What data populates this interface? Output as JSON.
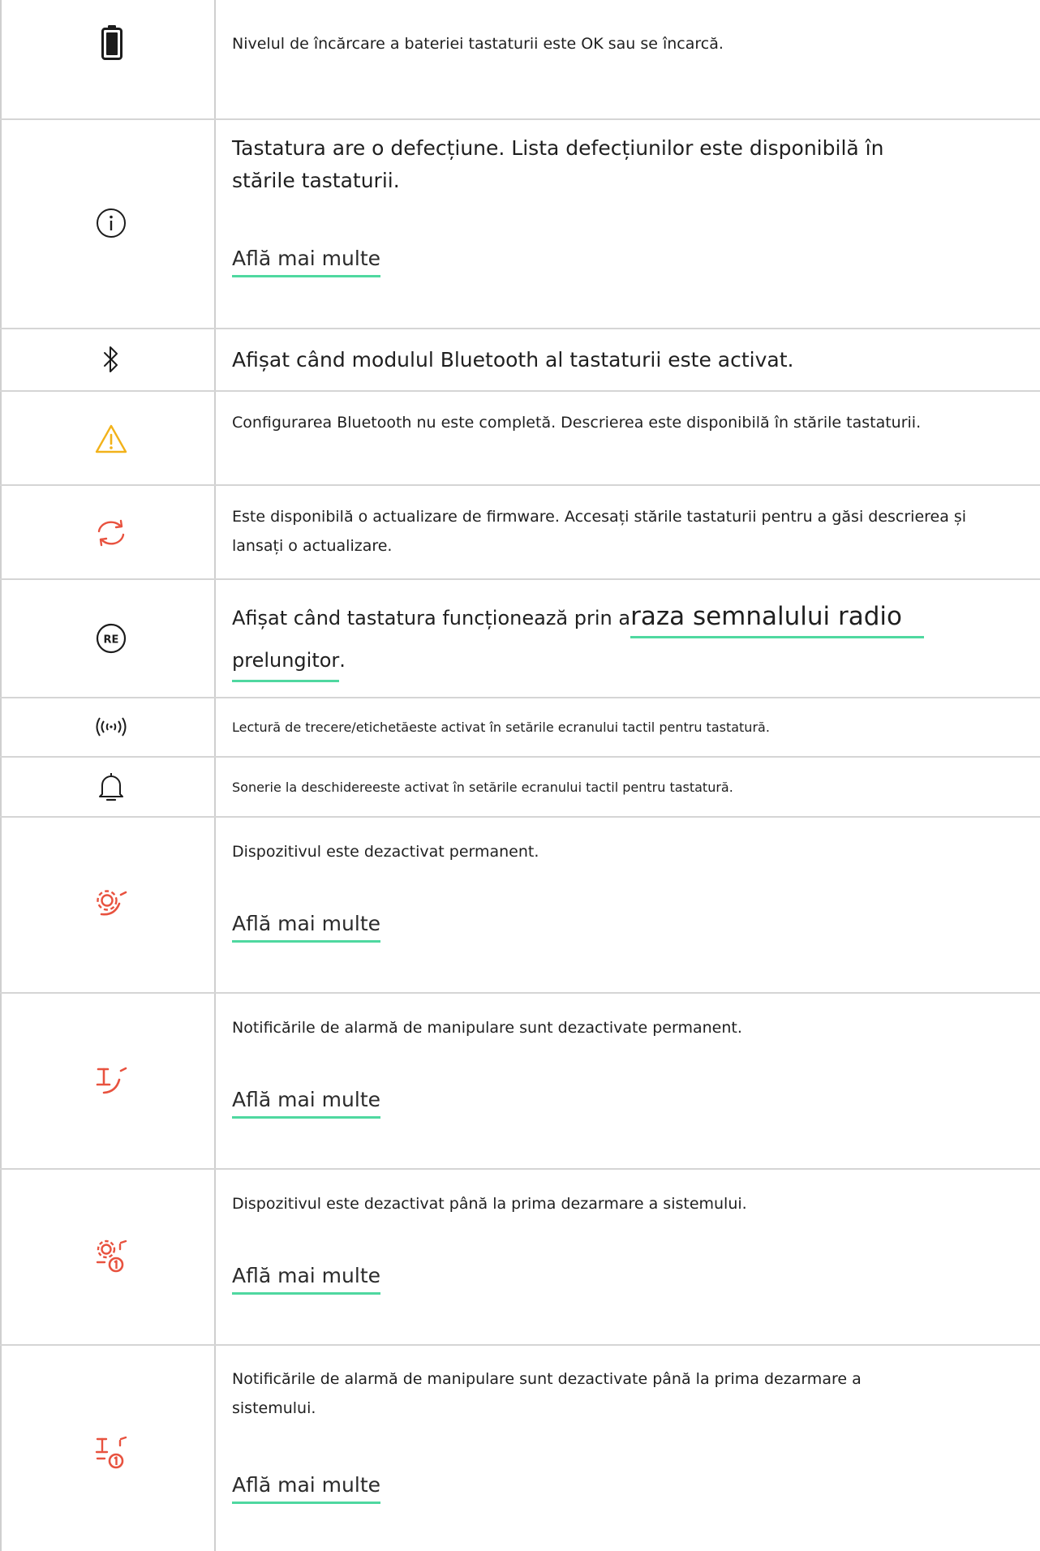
{
  "rows": [
    {
      "icon": "battery-icon",
      "text": "Nivelul de încărcare a bateriei tastaturii este OK sau se încarcă."
    },
    {
      "icon": "info-icon",
      "text": "Tastatura are o defecțiune. Lista defecțiunilor este disponibilă în stările tastaturii.",
      "link": "Află mai multe"
    },
    {
      "icon": "bluetooth-icon",
      "text": "Afișat când modulul Bluetooth al tastaturii este activat."
    },
    {
      "icon": "warning-icon",
      "text": "Configurarea Bluetooth nu este completă. Descrierea este disponibilă în stările tastaturii."
    },
    {
      "icon": "sync-icon",
      "text": "Este disponibilă o actualizare de firmware. Accesați stările tastaturii pentru a găsi descrierea și lansați o actualizare."
    },
    {
      "icon": "re-icon",
      "text_prefix": "Afișat când tastatura funcționează prin a",
      "text_link": "raza semnalului radio",
      "text_link2": "prelungitor",
      "text_suffix": "."
    },
    {
      "icon": "rfid-icon",
      "text": "Lectură de trecere/etichetăeste activat în setările ecranului tactil pentru tastatură."
    },
    {
      "icon": "bell-icon",
      "text": "Sonerie la deschidereeste activat în setările ecranului tactil pentru tastatură."
    },
    {
      "icon": "gear-disabled-icon",
      "text": "Dispozitivul este dezactivat permanent.",
      "link": "Află mai multe"
    },
    {
      "icon": "tamper-disabled-icon",
      "text": "Notificările de alarmă de manipulare sunt dezactivate permanent.",
      "link": "Află mai multe"
    },
    {
      "icon": "gear-disabled-once-icon",
      "text": "Dispozitivul este dezactivat până la prima dezarmare a sistemului.",
      "link": "Află mai multe"
    },
    {
      "icon": "tamper-disabled-once-icon",
      "text": "Notificările de alarmă de manipulare sunt dezactivate până la prima dezarmare a sistemului.",
      "link": "Află mai multe"
    }
  ],
  "colors": {
    "accent": "#4fd8a0",
    "warning": "#f2b21a",
    "alert": "#e8523f",
    "border": "#d5d5d5"
  }
}
